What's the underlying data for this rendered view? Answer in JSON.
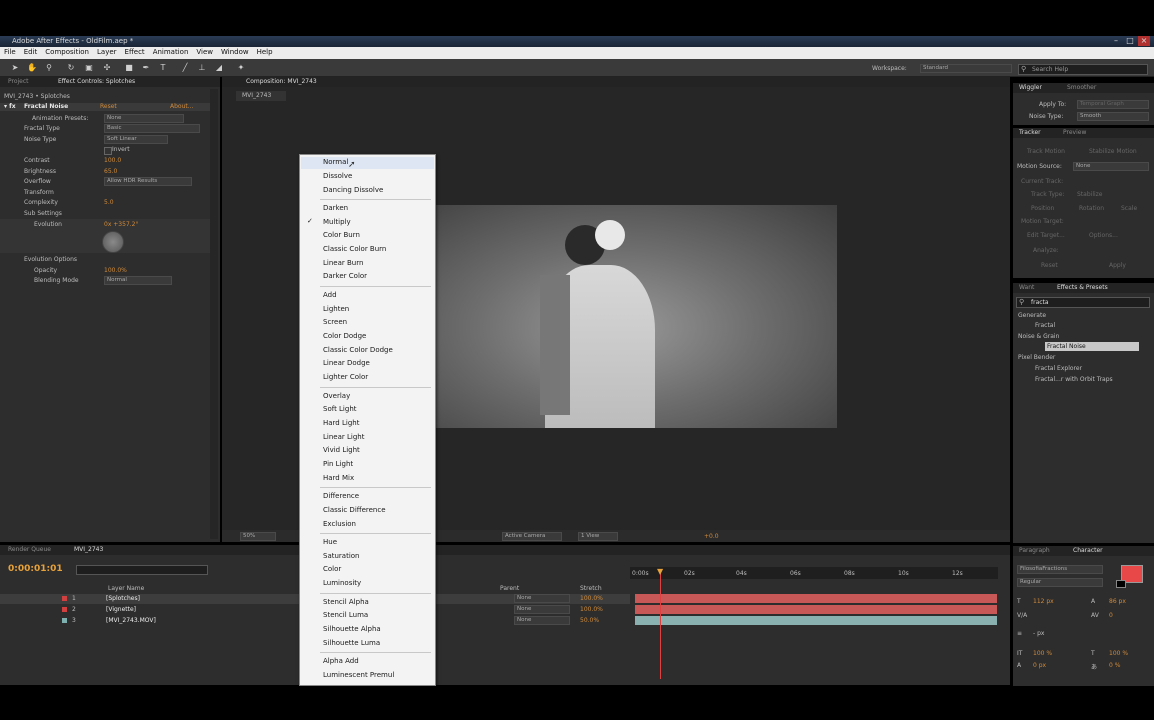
{
  "window": {
    "title": "Adobe After Effects - OldFilm.aep *"
  },
  "menubar": [
    "File",
    "Edit",
    "Composition",
    "Layer",
    "Effect",
    "Animation",
    "View",
    "Window",
    "Help"
  ],
  "toolbar": {
    "workspace_label": "Workspace:",
    "workspace_value": "Standard",
    "search_placeholder": "Search Help"
  },
  "project_panel": {
    "tab_project": "Project",
    "tab_effect_controls": "Effect Controls: Splotches",
    "breadcrumb": "MVI_2743 • Splotches",
    "effect_name": "Fractal Noise",
    "reset": "Reset",
    "about": "About...",
    "props": [
      {
        "label": "Animation Presets:",
        "value": "None"
      },
      {
        "label": "Fractal Type",
        "value": "Basic"
      },
      {
        "label": "Noise Type",
        "value": "Soft Linear"
      },
      {
        "label": "",
        "value": "Invert"
      },
      {
        "label": "Contrast",
        "value": "100.0"
      },
      {
        "label": "Brightness",
        "value": "65.0"
      },
      {
        "label": "Overflow",
        "value": "Allow HDR Results"
      },
      {
        "label": "Transform",
        "value": ""
      },
      {
        "label": "Complexity",
        "value": "5.0"
      },
      {
        "label": "Sub Settings",
        "value": ""
      },
      {
        "label": "Evolution",
        "value": "0x +357.2°"
      },
      {
        "label": "Evolution Options",
        "value": ""
      },
      {
        "label": "Opacity",
        "value": "100.0%"
      },
      {
        "label": "Blending Mode",
        "value": "Normal"
      }
    ]
  },
  "composition": {
    "tab": "Composition: MVI_2743",
    "sub_tab": "MVI_2743",
    "zoom": "50%",
    "camera": "Active Camera",
    "views": "1 View",
    "offset": "+0.0"
  },
  "blend_menu": {
    "groups": [
      [
        "Normal",
        "Dissolve",
        "Dancing Dissolve"
      ],
      [
        "Darken",
        "Multiply",
        "Color Burn",
        "Classic Color Burn",
        "Linear Burn",
        "Darker Color"
      ],
      [
        "Add",
        "Lighten",
        "Screen",
        "Color Dodge",
        "Classic Color Dodge",
        "Linear Dodge",
        "Lighter Color"
      ],
      [
        "Overlay",
        "Soft Light",
        "Hard Light",
        "Linear Light",
        "Vivid Light",
        "Pin Light",
        "Hard Mix"
      ],
      [
        "Difference",
        "Classic Difference",
        "Exclusion"
      ],
      [
        "Hue",
        "Saturation",
        "Color",
        "Luminosity"
      ],
      [
        "Stencil Alpha",
        "Stencil Luma",
        "Silhouette Alpha",
        "Silhouette Luma"
      ],
      [
        "Alpha Add",
        "Luminescent Premul"
      ]
    ],
    "checked": "Multiply"
  },
  "wiggler": {
    "tab1": "Wiggler",
    "tab2": "Smoother",
    "apply_to_label": "Apply To:",
    "apply_to_value": "Temporal Graph",
    "noise_type_label": "Noise Type:",
    "noise_type_value": "Smooth"
  },
  "tracker": {
    "tab1": "Tracker",
    "tab2": "Preview",
    "track_motion": "Track Motion",
    "stabilize_motion": "Stabilize Motion",
    "motion_source_label": "Motion Source:",
    "motion_source_value": "None",
    "current_track": "Current Track:",
    "track_type": "Track Type:",
    "track_type_value": "Stabilize",
    "position": "Position",
    "rotation": "Rotation",
    "scale": "Scale",
    "motion_target": "Motion Target:",
    "edit_target": "Edit Target...",
    "options": "Options...",
    "analyze": "Analyze:",
    "reset": "Reset",
    "apply": "Apply"
  },
  "effects_presets": {
    "tab_want": "Want",
    "tab": "Effects & Presets",
    "search_value": "fracta",
    "tree": [
      {
        "label": "Generate",
        "level": 0
      },
      {
        "label": "Fractal",
        "level": 1
      },
      {
        "label": "Noise & Grain",
        "level": 0
      },
      {
        "label": "Fractal Noise",
        "level": 1,
        "selected": true
      },
      {
        "label": "Pixel Bender",
        "level": 0
      },
      {
        "label": "Fractal Explorer",
        "level": 1
      },
      {
        "label": "Fractal...r with Orbit Traps",
        "level": 1
      }
    ]
  },
  "timeline": {
    "tab_render": "Render Queue",
    "tab_comp": "MVI_2743",
    "timecode": "0:00:01:01",
    "col_layer_name": "Layer Name",
    "col_parent": "Parent",
    "col_stretch": "Stretch",
    "layers": [
      {
        "num": "1",
        "name": "[Splotches]",
        "color": "#d04040",
        "parent": "None",
        "stretch": "100.0%"
      },
      {
        "num": "2",
        "name": "[Vignette]",
        "color": "#d04040",
        "parent": "None",
        "stretch": "100.0%"
      },
      {
        "num": "3",
        "name": "[MVI_2743.MOV]",
        "color": "#7fb0b0",
        "parent": "None",
        "stretch": "50.0%"
      }
    ],
    "ruler": [
      "0:00s",
      "02s",
      "04s",
      "06s",
      "08s",
      "10s",
      "12s"
    ]
  },
  "character": {
    "tab_paragraph": "Paragraph",
    "tab_character": "Character",
    "font": "FilosofiaFractions",
    "style": "Regular",
    "size": "112 px",
    "leading": "86 px",
    "kerning": "",
    "tracking": "0",
    "unit": "- px",
    "vscale": "100 %",
    "hscale": "100 %",
    "baseline": "0 px",
    "tsume": "0 %",
    "color_fill": "#e84848"
  }
}
